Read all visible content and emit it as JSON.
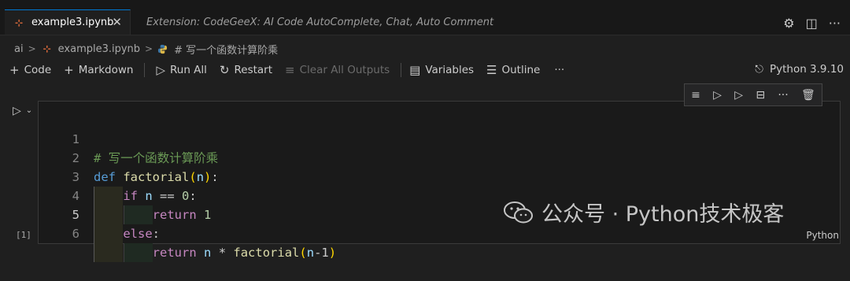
{
  "tabs": [
    {
      "label": "example3.ipynb",
      "active": true,
      "icon": "notebook-icon"
    },
    {
      "label": "Extension: CodeGeeX: AI Code AutoComplete, Chat, Auto Comment",
      "active": false,
      "icon": "extension-icon"
    }
  ],
  "breadcrumb": [
    "ai",
    "example3.ipynb",
    "# 写一个函数计算阶乘"
  ],
  "toolbar": {
    "code": "Code",
    "markdown": "Markdown",
    "run_all": "Run All",
    "restart": "Restart",
    "clear_all_outputs": "Clear All Outputs",
    "variables": "Variables",
    "outline": "Outline",
    "more": "···"
  },
  "kernel": "Python 3.9.10",
  "cell": {
    "execution_count": "[1]",
    "language": "Python",
    "line_numbers": [
      "1",
      "2",
      "3",
      "4",
      "5",
      "6"
    ],
    "comment": "# 写一个函数计算阶乘",
    "kw_def": "def",
    "fn_name": "factorial",
    "param": "n",
    "kw_if": "if",
    "var_n": "n",
    "op_eq": "==",
    "zero": "0",
    "kw_return": "return",
    "one": "1",
    "kw_else": "else",
    "op_mul": "*",
    "minus_one": "-1"
  },
  "watermark": "公众号 · Python技术极客",
  "colors": {
    "accent": "#0078d4",
    "keyword": "#569cd6",
    "control": "#c586c0",
    "function": "#dcdcaa",
    "comment": "#6a9955"
  }
}
